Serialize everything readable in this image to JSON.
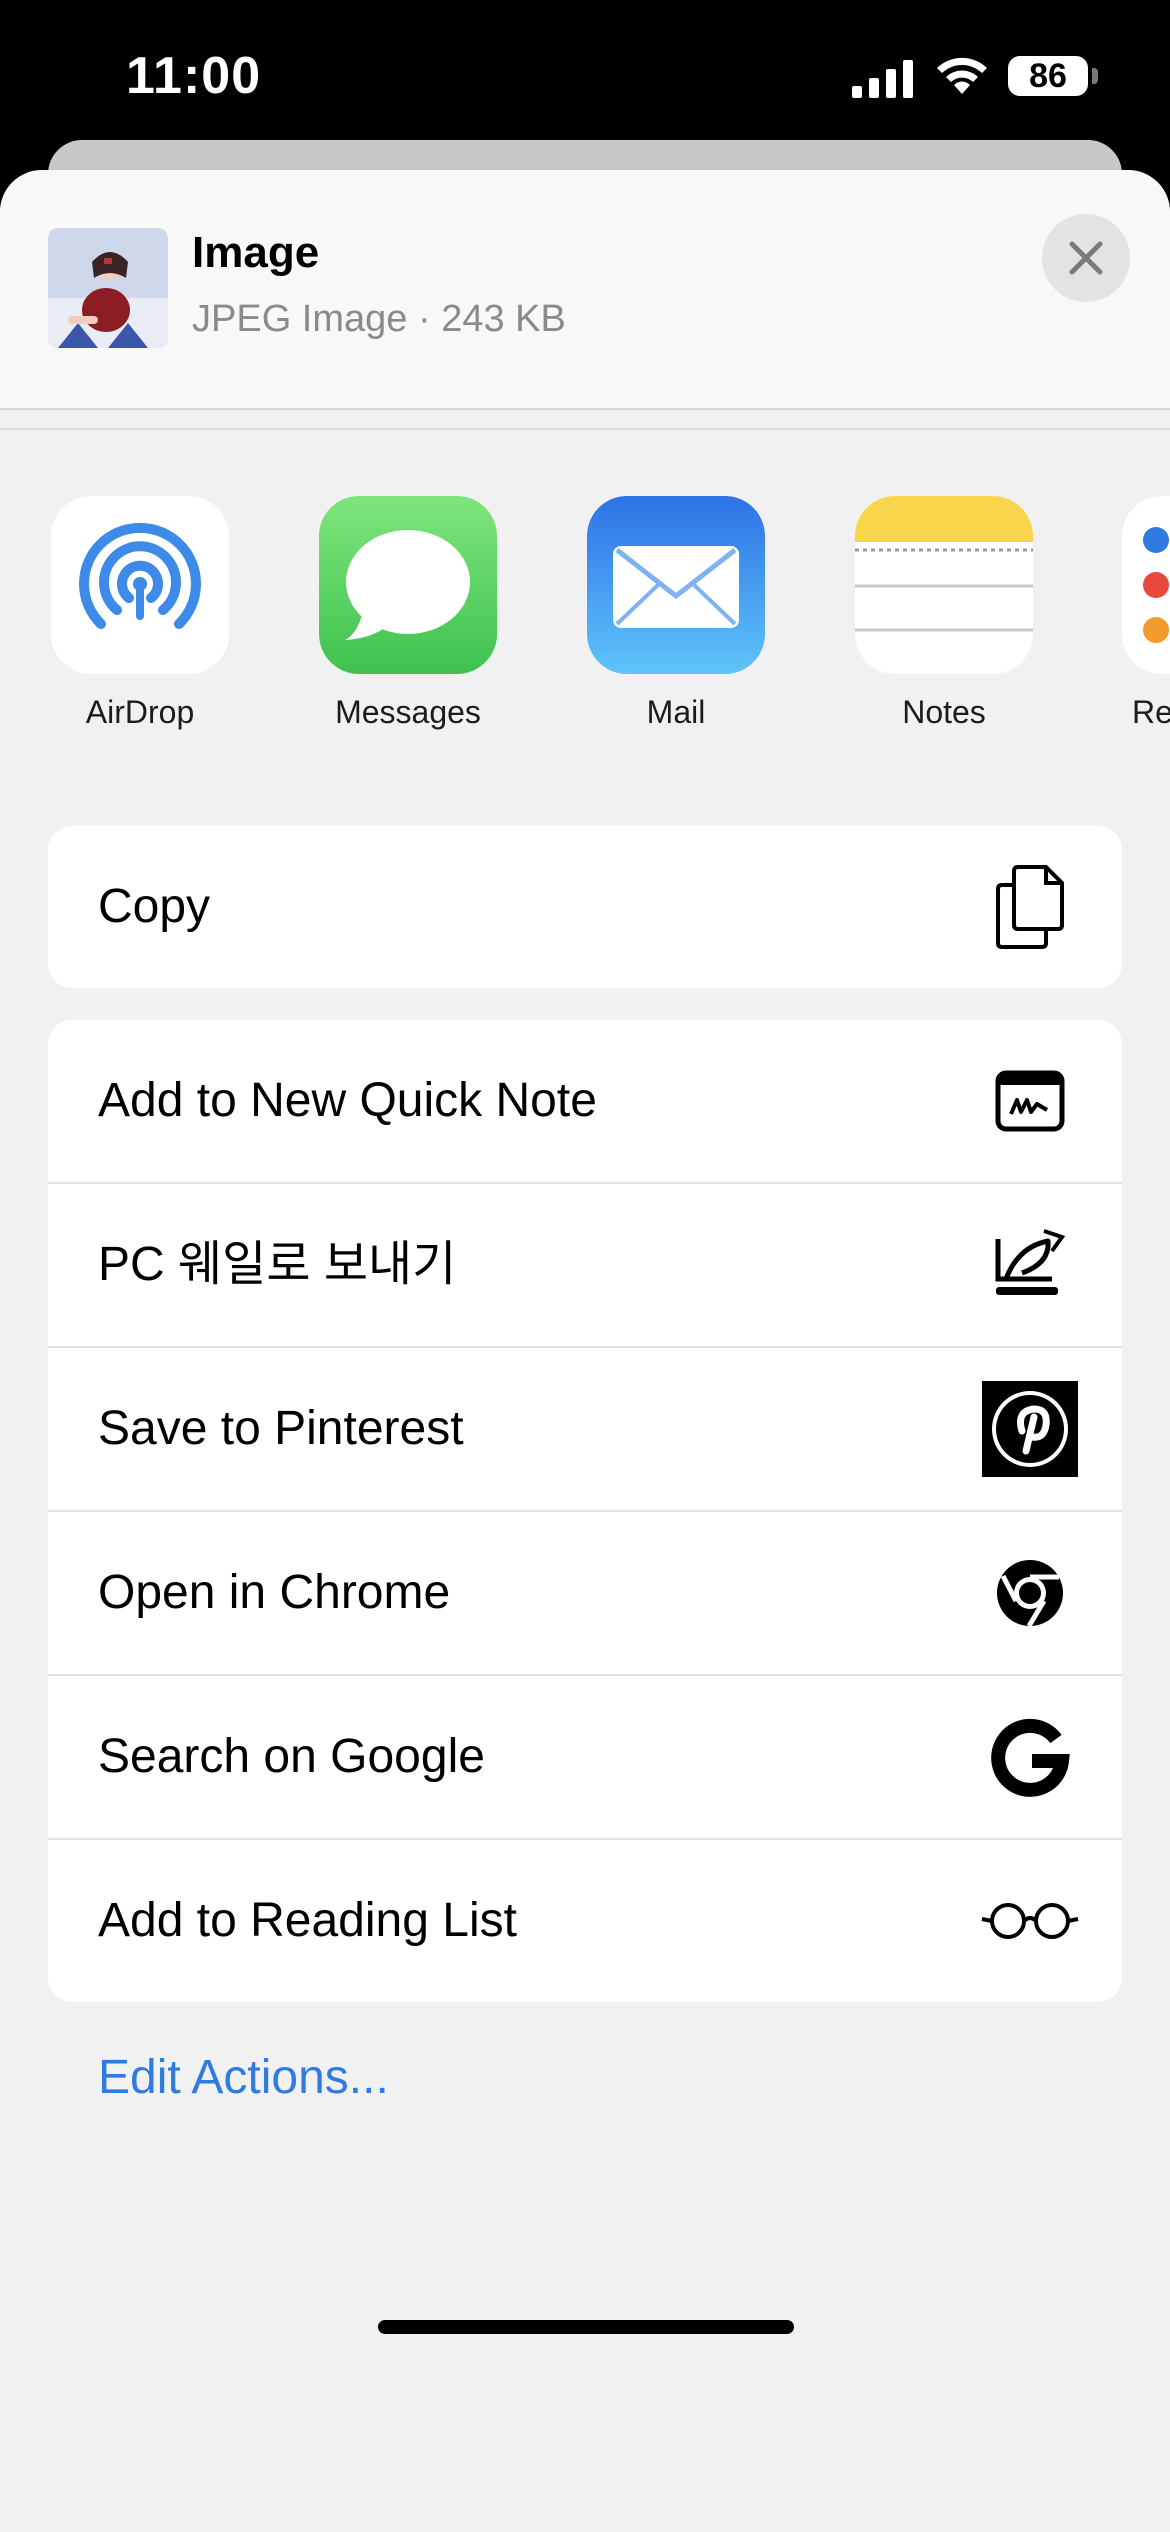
{
  "status_bar": {
    "time": "11:00",
    "battery": "86"
  },
  "header": {
    "title": "Image",
    "subtitle": "JPEG Image · 243 KB"
  },
  "apps": [
    {
      "label": "AirDrop",
      "icon": "airdrop-icon"
    },
    {
      "label": "Messages",
      "icon": "messages-icon"
    },
    {
      "label": "Mail",
      "icon": "mail-icon"
    },
    {
      "label": "Notes",
      "icon": "notes-icon"
    },
    {
      "label": "Re",
      "icon": "reminders-icon"
    }
  ],
  "copy_group": {
    "copy_label": "Copy"
  },
  "actions": [
    {
      "label": "Add to New Quick Note",
      "icon": "quick-note-icon"
    },
    {
      "label": "PC 웨일로 보내기",
      "icon": "whale-send-icon"
    },
    {
      "label": "Save to Pinterest",
      "icon": "pinterest-icon"
    },
    {
      "label": "Open in Chrome",
      "icon": "chrome-icon"
    },
    {
      "label": "Search on Google",
      "icon": "google-icon"
    },
    {
      "label": "Add to Reading List",
      "icon": "glasses-icon"
    }
  ],
  "edit_actions_label": "Edit Actions...",
  "colors": {
    "accent": "#2f7be0",
    "messages_green": "#4cd964",
    "mail_blue": "#3a8cf0",
    "notes_yellow": "#f7d64a"
  }
}
